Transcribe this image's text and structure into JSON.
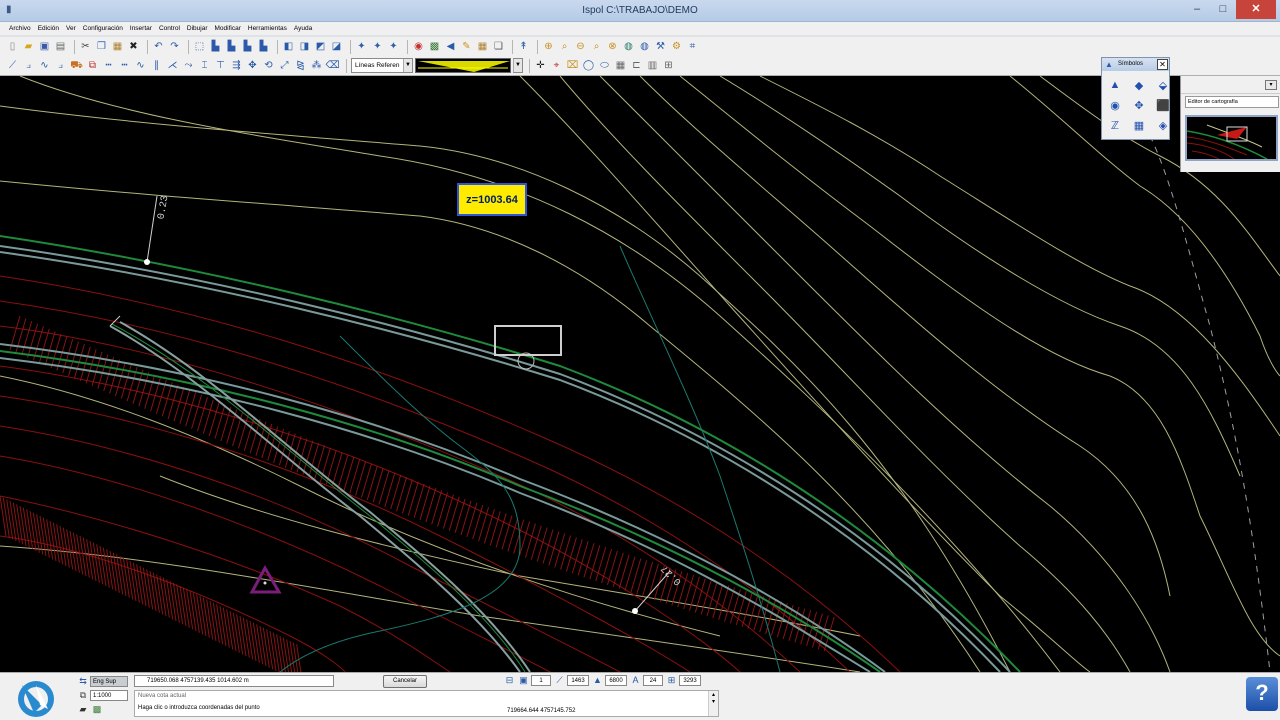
{
  "window": {
    "title": "Ispol  C:\\TRABAJO\\DEMO",
    "system_icon": "app-icon",
    "buttons": {
      "minimize": "–",
      "maximize": "□",
      "close": "✕"
    }
  },
  "menu": [
    "Archivo",
    "Edición",
    "Ver",
    "Configuración",
    "Insertar",
    "Control",
    "Dibujar",
    "Modificar",
    "Herramientas",
    "Ayuda"
  ],
  "toolbar": {
    "row1_icons": [
      "new-file-icon",
      "open-folder-icon",
      "save-icon",
      "print-icon",
      "cut-icon",
      "copy-icon",
      "paste-icon",
      "delete-icon",
      "undo-icon",
      "redo-icon",
      "select-icon",
      "layer-icon",
      "layer-icon",
      "layer-icon",
      "layer-icon",
      "view-icon",
      "view-icon",
      "view-icon",
      "view-icon",
      "snap-icon",
      "snap-icon",
      "snap-icon",
      "palette-icon",
      "image-icon",
      "arrow-icon",
      "pencil-icon",
      "table-icon",
      "copy-window-icon",
      "marker-icon",
      "zoom-in-icon",
      "zoom-icon",
      "zoom-out-icon",
      "zoom-window-icon",
      "zoom-extents-icon",
      "globe-icon",
      "globe-icon",
      "tools-icon",
      "gear-icon",
      "grid-icon"
    ],
    "row2_icons": [
      "line-icon",
      "polyline-icon",
      "spline-icon",
      "truck-icon",
      "node-icon",
      "dashed-icon",
      "dashed-icon",
      "parallel-icon",
      "parallel-icon",
      "trim-icon",
      "extend-icon",
      "join-icon",
      "break-icon",
      "offset-icon",
      "move-icon",
      "rotate-icon",
      "scale-icon",
      "mirror-icon",
      "array-icon",
      "erase-icon"
    ],
    "line_type": "Líneas Referen",
    "line_preview_label": "",
    "row2_right_icons": [
      "crosshair-icon",
      "measure-icon",
      "eraser-icon",
      "circle-icon",
      "ellipse-icon",
      "table-icon",
      "text-icon",
      "hatch-icon",
      "block-icon"
    ]
  },
  "canvas": {
    "elevation_label": "z=1003.64",
    "pk_labels": [
      "0.23",
      "0.27"
    ]
  },
  "symbols_panel": {
    "title": "Símbolos",
    "icons": [
      "triangle-icon",
      "diamond-icon",
      "waypoint-icon",
      "vertex-icon",
      "move-point-icon",
      "marker-icon",
      "z-axis-icon",
      "table-icon",
      "layers-icon"
    ]
  },
  "right_panel": {
    "combo": "Editor de cartografía"
  },
  "statusbar": {
    "mode": "Eng Sup",
    "scale": "1:1000",
    "coords": "719650.068   4757139.435   1014.602       m",
    "cancel": "Cancelar",
    "history_line": "Nueva cota actual",
    "prompt": "Haga clic o introduzca coordenadas del punto",
    "cursor_coords": "719664.644   4757145.752",
    "ind_values": [
      "1",
      "1463",
      "6800",
      "24",
      "3293"
    ],
    "help": "?"
  }
}
